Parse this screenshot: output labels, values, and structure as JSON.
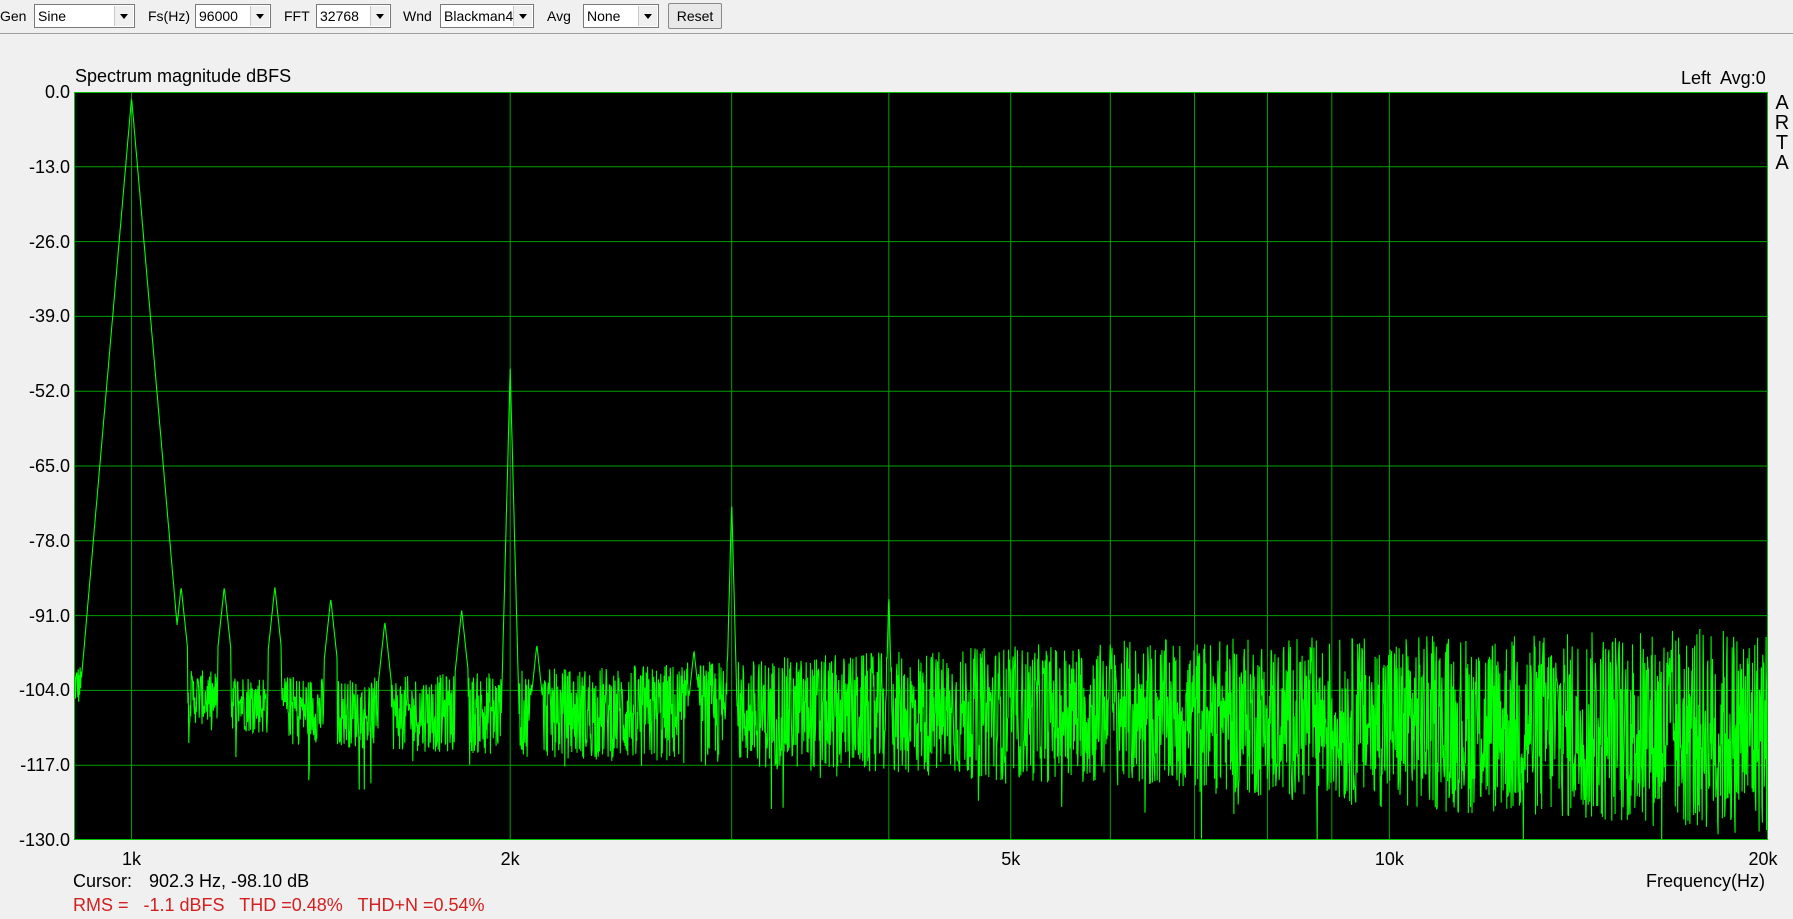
{
  "toolbar": {
    "gen_label": "Gen",
    "gen_value": "Sine",
    "fs_label": "Fs(Hz)",
    "fs_value": "96000",
    "fft_label": "FFT",
    "fft_value": "32768",
    "wnd_label": "Wnd",
    "wnd_value": "Blackman4",
    "avg_label": "Avg",
    "avg_value": "None",
    "reset_label": "Reset"
  },
  "plot": {
    "title": "Spectrum magnitude dBFS",
    "channel": "Left",
    "avg_status": "Avg:0",
    "brand_letters": [
      "A",
      "R",
      "T",
      "A"
    ],
    "cursor_label": "Cursor:",
    "cursor_value": "902.3 Hz, -98.10 dB",
    "stats": "RMS =   -1.1 dBFS   THD =0.48%   THD+N =0.54%",
    "xaxis_label": "Frequency(Hz)",
    "colors": {
      "background": "#000000",
      "grid": "#00a000",
      "trace": "#00ff00",
      "frame": "#00c000",
      "stats_text": "#d42020"
    }
  },
  "chart_data": {
    "type": "line",
    "title": "Spectrum magnitude dBFS",
    "xlabel": "Frequency(Hz)",
    "ylabel": "",
    "xscale": "log",
    "xlim": [
      900,
      20000
    ],
    "ylim": [
      -130,
      0
    ],
    "y_ticks": [
      "0.0",
      "-13.0",
      "-26.0",
      "-39.0",
      "-52.0",
      "-65.0",
      "-78.0",
      "-91.0",
      "-104.0",
      "-117.0",
      "-130.0"
    ],
    "x_ticks": [
      {
        "label": "1k",
        "value": 1000
      },
      {
        "label": "2k",
        "value": 2000
      },
      {
        "label": "5k",
        "value": 5000
      },
      {
        "label": "10k",
        "value": 10000
      },
      {
        "label": "20k",
        "value": 20000
      }
    ],
    "grid": true,
    "series": [
      {
        "peaks": [
          {
            "x": 1000,
            "y": -1
          },
          {
            "x": 2000,
            "y": -48
          },
          {
            "x": 3000,
            "y": -71
          },
          {
            "x": 4000,
            "y": -87
          },
          {
            "x": 6000,
            "y": -95
          }
        ],
        "spurs": [
          {
            "x": 945,
            "y": -86
          },
          {
            "x": 1095,
            "y": -86
          },
          {
            "x": 1185,
            "y": -86
          },
          {
            "x": 1300,
            "y": -86
          },
          {
            "x": 1440,
            "y": -88
          },
          {
            "x": 1590,
            "y": -92
          },
          {
            "x": 1830,
            "y": -90
          },
          {
            "x": 2100,
            "y": -96
          },
          {
            "x": 2800,
            "y": -97
          }
        ],
        "noise_floor": [
          {
            "x": 900,
            "y": -103
          },
          {
            "x": 1500,
            "y": -108
          },
          {
            "x": 3000,
            "y": -108
          },
          {
            "x": 6000,
            "y": -108
          },
          {
            "x": 12000,
            "y": -110
          },
          {
            "x": 20000,
            "y": -111
          }
        ]
      }
    ]
  }
}
